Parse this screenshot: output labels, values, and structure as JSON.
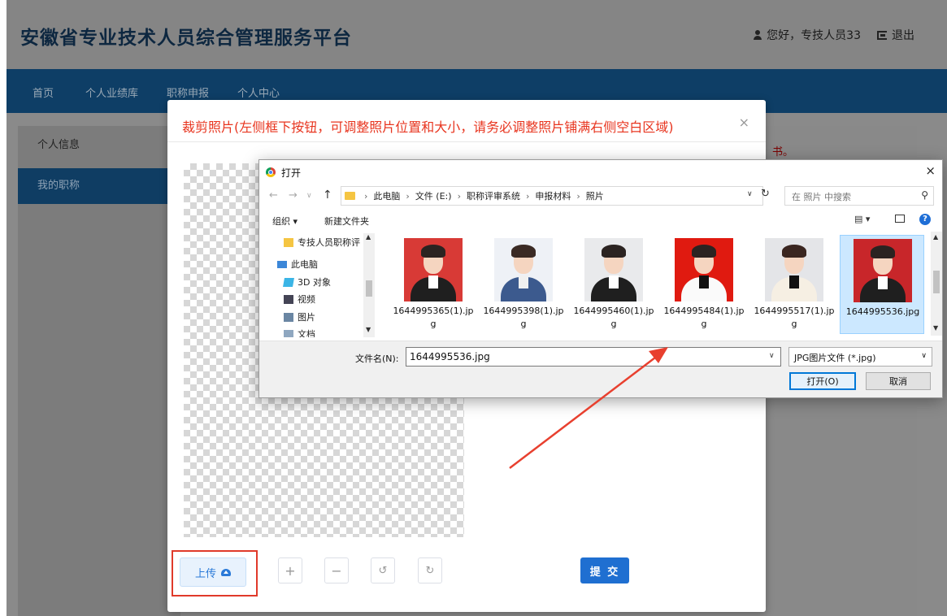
{
  "header": {
    "site_title": "安徽省专业技术人员综合管理服务平台",
    "greeting": "您好，专技人员33",
    "logout": "退出"
  },
  "nav": {
    "items": [
      "首页",
      "个人业绩库",
      "职称申报",
      "个人中心"
    ]
  },
  "sidebar": {
    "items": [
      {
        "label": "个人信息",
        "active": false
      },
      {
        "label": "我的职称",
        "active": true
      }
    ]
  },
  "background": {
    "partial_red_text": "书。"
  },
  "crop_dialog": {
    "title": "裁剪照片(左侧框下按钮，可调整照片位置和大小，请务必调整照片铺满右侧空白区域)",
    "close_symbol": "×",
    "upload_label": "上传",
    "tools": [
      "+",
      "−",
      "↺",
      "↻"
    ],
    "submit_label": "提 交"
  },
  "file_dialog": {
    "title": "打开",
    "close_symbol": "×",
    "breadcrumb": [
      "此电脑",
      "文件 (E:)",
      "职称评审系统",
      "申报材料",
      "照片"
    ],
    "search_placeholder": "在 照片 中搜索",
    "toolbar": {
      "organize": "组织 ▾",
      "new_folder": "新建文件夹"
    },
    "nav_items": [
      {
        "label": "专技人员职称评",
        "icon": "folder-icon"
      },
      {
        "label": "此电脑",
        "icon": "computer-icon"
      },
      {
        "label": "3D 对象",
        "icon": "3d-objects-icon"
      },
      {
        "label": "视频",
        "icon": "video-icon"
      },
      {
        "label": "图片",
        "icon": "pictures-icon"
      },
      {
        "label": "文档",
        "icon": "documents-icon"
      }
    ],
    "files": [
      {
        "name": "1644995365(1).jpg",
        "bg": "#d83a36",
        "selected": false
      },
      {
        "name": "1644995398(1).jpg",
        "bg": "#eef1f6",
        "selected": false
      },
      {
        "name": "1644995460(1).jpg",
        "bg": "#e9eaec",
        "selected": false
      },
      {
        "name": "1644995484(1).jpg",
        "bg": "#e01a10",
        "selected": false
      },
      {
        "name": "1644995517(1).jpg",
        "bg": "#e4e5e8",
        "selected": false
      },
      {
        "name": "1644995536.jpg",
        "bg": "#c8262a",
        "selected": true
      }
    ],
    "filename_label": "文件名(N):",
    "filename_value": "1644995536.jpg",
    "filetype_value": "JPG图片文件 (*.jpg)",
    "open_label": "打开(O)",
    "cancel_label": "取消"
  },
  "annotation": {
    "arrow_color": "#e8402f",
    "highlight_color": "#e03a2a"
  }
}
